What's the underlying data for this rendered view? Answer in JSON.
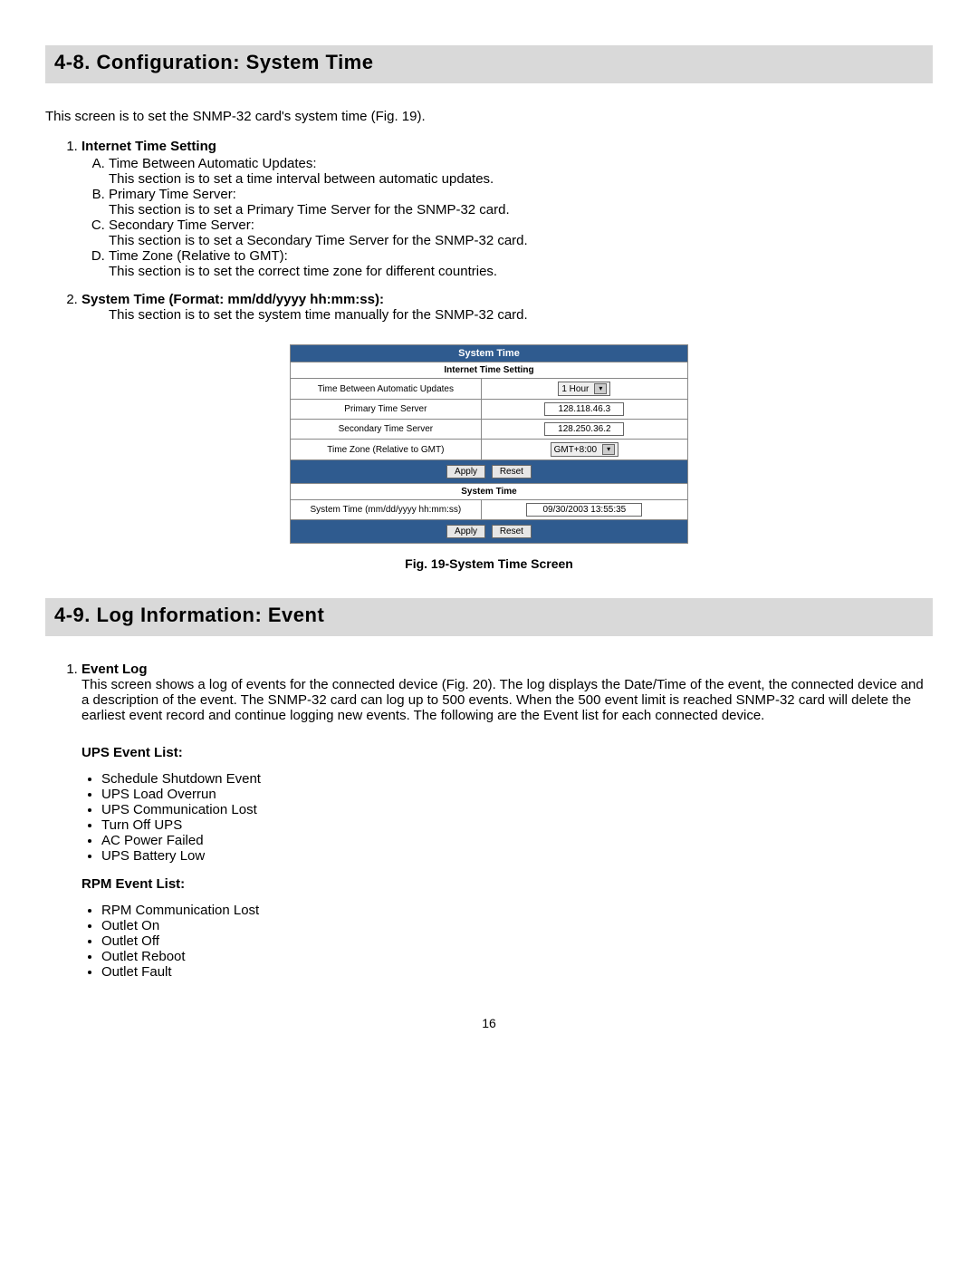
{
  "section48": {
    "heading": "4-8. Configuration: System Time",
    "intro": "This screen is to set the SNMP-32 card's system time (Fig. 19).",
    "item1_label": "Internet Time Setting",
    "item1_A_title": "Time Between Automatic Updates:",
    "item1_A_desc": "This section is to set a time interval between automatic updates.",
    "item1_B_title": "Primary Time Server:",
    "item1_B_desc": "This section is to set a Primary Time Server for the SNMP-32 card.",
    "item1_C_title": "Secondary Time Server:",
    "item1_C_desc": "This section is to set a Secondary Time Server for the SNMP-32 card.",
    "item1_D_title": "Time Zone (Relative to GMT):",
    "item1_D_desc": "This section is to set the correct time zone for different countries.",
    "item2_label": "System Time (Format:  mm/dd/yyyy hh:mm:ss):",
    "item2_desc": "This section is to set the system time manually for the SNMP-32 card."
  },
  "figure": {
    "hdr_main": "System Time",
    "hdr_internet": "Internet Time Setting",
    "row1_label": "Time Between Automatic Updates",
    "row1_value": "1 Hour",
    "row2_label": "Primary Time Server",
    "row2_value": "128.118.46.3",
    "row3_label": "Secondary Time Server",
    "row3_value": "128.250.36.2",
    "row4_label": "Time Zone (Relative to GMT)",
    "row4_value": "GMT+8:00",
    "btn_apply": "Apply",
    "btn_reset": "Reset",
    "hdr_system": "System Time",
    "row5_label": "System Time (mm/dd/yyyy hh:mm:ss)",
    "row5_value": "09/30/2003 13:55:35",
    "caption": "Fig. 19-System Time Screen"
  },
  "section49": {
    "heading": "4-9. Log Information: Event",
    "item1_label": "Event Log",
    "item1_body": "This screen shows a log of events for the connected device (Fig. 20).  The log displays the Date/Time of the event, the connected device and a description of the event.  The SNMP-32 card can log up to 500 events.  When the 500 event limit is reached SNMP-32 card will delete the earliest event record and continue logging new events.  The following are the Event list for each connected device.",
    "ups_heading": "UPS Event List:",
    "ups": {
      "e0": "Schedule Shutdown Event",
      "e1": "UPS Load Overrun",
      "e2": "UPS Communication Lost",
      "e3": "Turn Off UPS",
      "e4": "AC Power Failed",
      "e5": "UPS Battery Low"
    },
    "rpm_heading": "RPM Event List:",
    "rpm": {
      "e0": "RPM Communication Lost",
      "e1": "Outlet On",
      "e2": "Outlet Off",
      "e3": "Outlet Reboot",
      "e4": "Outlet Fault"
    }
  },
  "page_number": "16"
}
